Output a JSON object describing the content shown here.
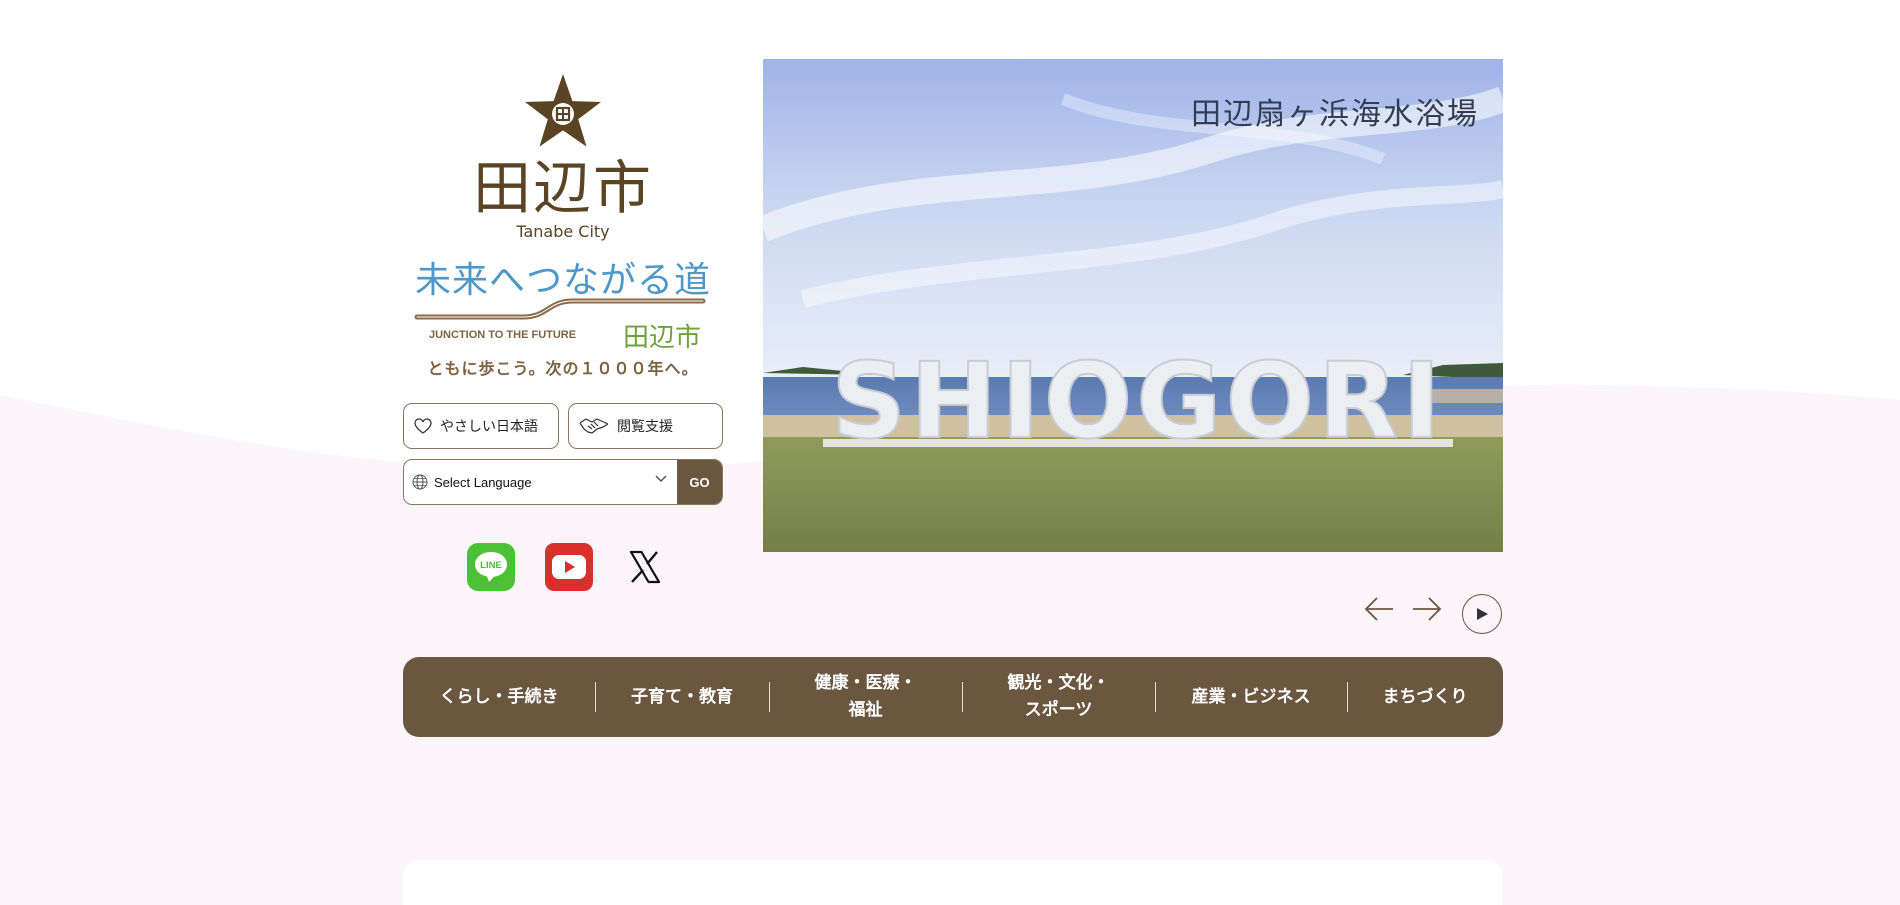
{
  "brand": {
    "city_name": "田辺市",
    "city_name_en": "Tanabe City",
    "logo_icon": "star-emblem-icon"
  },
  "slogan": {
    "main": "未来へつながる道",
    "en": "JUNCTION TO THE FUTURE",
    "city": "田辺市",
    "sub": "ともに歩こう。次の１０００年へ。"
  },
  "tools": {
    "easy_japanese": "やさしい日本語",
    "browsing_support": "閲覧支援"
  },
  "language": {
    "selected": "Select Language",
    "go_label": "GO"
  },
  "social": {
    "line_label": "LINE"
  },
  "hero": {
    "caption": "田辺扇ヶ浜海水浴場",
    "sign_text": "SHIOGORI"
  },
  "nav": {
    "items": [
      {
        "label": "くらし・手続き"
      },
      {
        "label": "子育て・教育"
      },
      {
        "label": "健康・医療・\n福祉"
      },
      {
        "label": "観光・文化・\nスポーツ"
      },
      {
        "label": "産業・ビジネス"
      },
      {
        "label": "まちづくり"
      }
    ]
  },
  "colors": {
    "brown": "#6b5640",
    "logo_brown": "#5a4424",
    "slogan_blue": "#4d98c8",
    "slogan_green": "#6fa23a",
    "bg_pink": "#fbf4f9"
  }
}
